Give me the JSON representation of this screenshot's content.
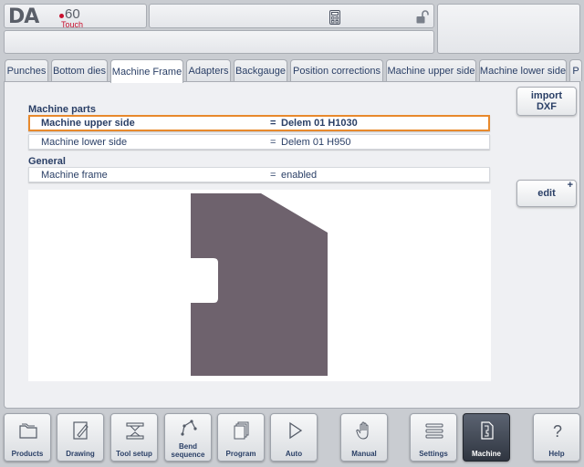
{
  "logo": {
    "brand": "DA",
    "model": "60",
    "touch": "Touch"
  },
  "colors": {
    "accent_orange": "#e8892c",
    "text_blue": "#2a3f66",
    "logo_red": "#c8102e",
    "frame_fill": "#6e626d"
  },
  "tabs": [
    {
      "label": "Punches"
    },
    {
      "label": "Bottom dies"
    },
    {
      "label": "Machine Frame",
      "active": true
    },
    {
      "label": "Adapters"
    },
    {
      "label": "Backgauge"
    },
    {
      "label": "Position corrections"
    },
    {
      "label": "Machine upper side"
    },
    {
      "label": "Machine lower side"
    },
    {
      "label": "P"
    }
  ],
  "sections": {
    "machine_parts": {
      "title": "Machine parts",
      "rows": [
        {
          "label": "Machine upper side",
          "eq": "=",
          "value": "Delem 01 H1030"
        },
        {
          "label": "Machine lower side",
          "eq": "=",
          "value": "Delem 01 H950"
        }
      ]
    },
    "general": {
      "title": "General",
      "rows": [
        {
          "label": "Machine frame",
          "eq": "=",
          "value": "enabled"
        }
      ]
    }
  },
  "side_buttons": {
    "import_line1": "import",
    "import_line2": "DXF",
    "edit": "edit",
    "edit_plus": "+"
  },
  "bottom_nav": [
    {
      "label": "Products",
      "icon": "folder-icon"
    },
    {
      "label": "Drawing",
      "icon": "drawing-icon"
    },
    {
      "label": "Tool setup",
      "icon": "tool-setup-icon"
    },
    {
      "label": "Bend",
      "label2": "sequence",
      "icon": "bend-sequence-icon"
    },
    {
      "label": "Program",
      "icon": "program-icon"
    },
    {
      "label": "Auto",
      "icon": "play-icon"
    },
    {
      "label": "Manual",
      "icon": "hand-icon"
    },
    {
      "label": "Settings",
      "icon": "settings-list-icon"
    },
    {
      "label": "Machine",
      "icon": "machine-icon",
      "active": true
    },
    {
      "label": "Help",
      "icon": "help-icon"
    }
  ]
}
